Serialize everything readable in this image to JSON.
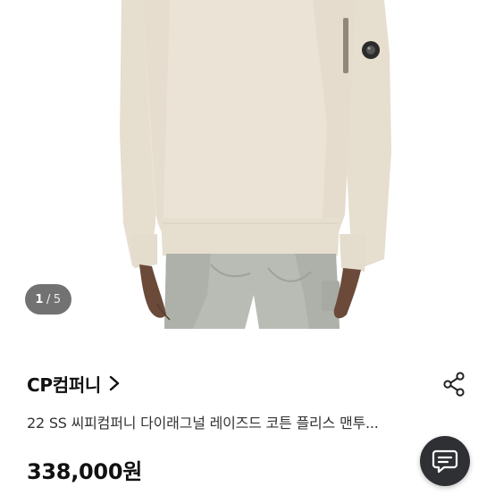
{
  "product_image": {
    "counter_current": "1",
    "counter_separator": "/",
    "counter_total": "5",
    "colors": {
      "sweatshirt": "#ebe3d6",
      "sweatshirt_shadow": "#d9d0c1",
      "pants": "#b9bcb5",
      "skin": "#6b4a3a"
    }
  },
  "shop": {
    "name": "CP컴퍼니",
    "chevron_icon": "chevron-right-icon"
  },
  "share": {
    "icon": "share-icon"
  },
  "product": {
    "title": "22 SS 씨피컴퍼니 다이래그널 레이즈드 코튼 플리스 맨투...",
    "price": "338,000원"
  },
  "chat": {
    "icon": "chat-bubble-icon"
  }
}
